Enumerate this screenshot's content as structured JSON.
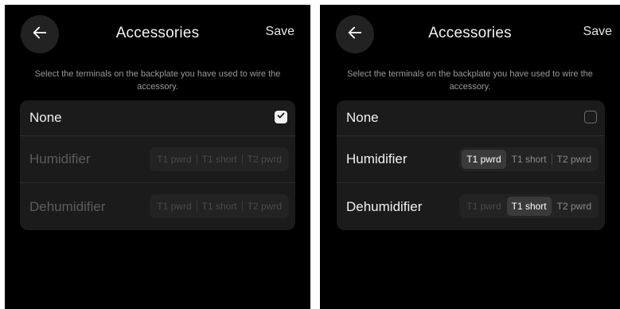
{
  "screens": [
    {
      "header": {
        "title": "Accessories",
        "save_label": "Save",
        "back_icon": "arrow-left-icon"
      },
      "instructions": "Select the terminals on the backplate you have used to wire the accessory.",
      "options": [
        {
          "label": "None",
          "checked": true
        },
        {
          "label": "Humidifier",
          "enabled": false,
          "segments": [
            "T1 pwrd",
            "T1 short",
            "T2 pwrd"
          ],
          "selected": null
        },
        {
          "label": "Dehumidifier",
          "enabled": false,
          "segments": [
            "T1 pwrd",
            "T1 short",
            "T2 pwrd"
          ],
          "selected": null
        }
      ]
    },
    {
      "header": {
        "title": "Accessories",
        "save_label": "Save",
        "back_icon": "arrow-left-icon"
      },
      "instructions": "Select the terminals on the backplate you have used to wire the accessory.",
      "options": [
        {
          "label": "None",
          "checked": false
        },
        {
          "label": "Humidifier",
          "enabled": true,
          "segments": [
            "T1 pwrd",
            "T1 short",
            "T2 pwrd"
          ],
          "selected": "T1 pwrd"
        },
        {
          "label": "Dehumidifier",
          "enabled": true,
          "segments": [
            "T1 pwrd",
            "T1 short",
            "T2 pwrd"
          ],
          "selected": "T1 short"
        }
      ]
    }
  ],
  "colors": {
    "background": "#000000",
    "card": "#1b1b1b",
    "text": "#ffffff",
    "muted": "#9a9a9a",
    "disabled": "#5c5c5c"
  }
}
